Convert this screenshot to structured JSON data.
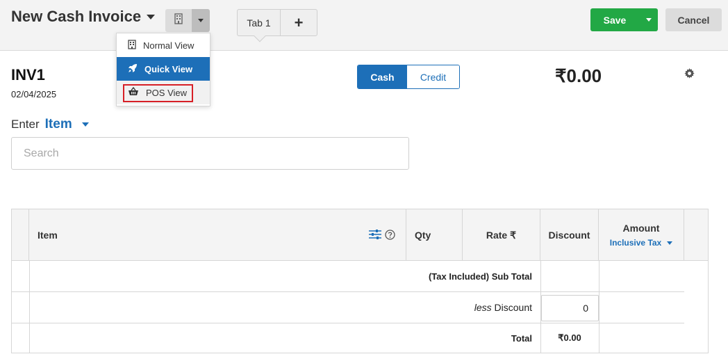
{
  "header": {
    "title": "New Cash Invoice",
    "tab_label": "Tab 1",
    "add_tab_symbol": "+",
    "save_label": "Save",
    "cancel_label": "Cancel"
  },
  "view_menu": {
    "items": [
      {
        "label": "Normal View",
        "icon": "building-icon"
      },
      {
        "label": "Quick View",
        "icon": "rocket-icon"
      },
      {
        "label": "POS View",
        "icon": "basket-icon"
      }
    ],
    "selected": "Quick View",
    "highlighted": "POS View"
  },
  "invoice": {
    "number": "INV1",
    "date": "02/04/2025",
    "payment_modes": [
      "Cash",
      "Credit"
    ],
    "selected_mode": "Cash",
    "total": "₹0.00"
  },
  "entry": {
    "prefix": "Enter",
    "mode": "Item",
    "search_placeholder": "Search"
  },
  "table": {
    "columns": {
      "item": "Item",
      "qty": "Qty",
      "rate": "Rate ₹",
      "discount": "Discount",
      "amount": "Amount",
      "amount_sub": "Inclusive Tax"
    },
    "summary": {
      "subtotal_label": "(Tax Included) Sub Total",
      "discount_prefix": "less",
      "discount_label": "Discount",
      "discount_value": "0",
      "total_label": "Total",
      "total_value": "₹0.00"
    }
  },
  "colors": {
    "primary": "#1d6fb8",
    "save": "#22a845",
    "highlight_border": "#d71f26"
  }
}
